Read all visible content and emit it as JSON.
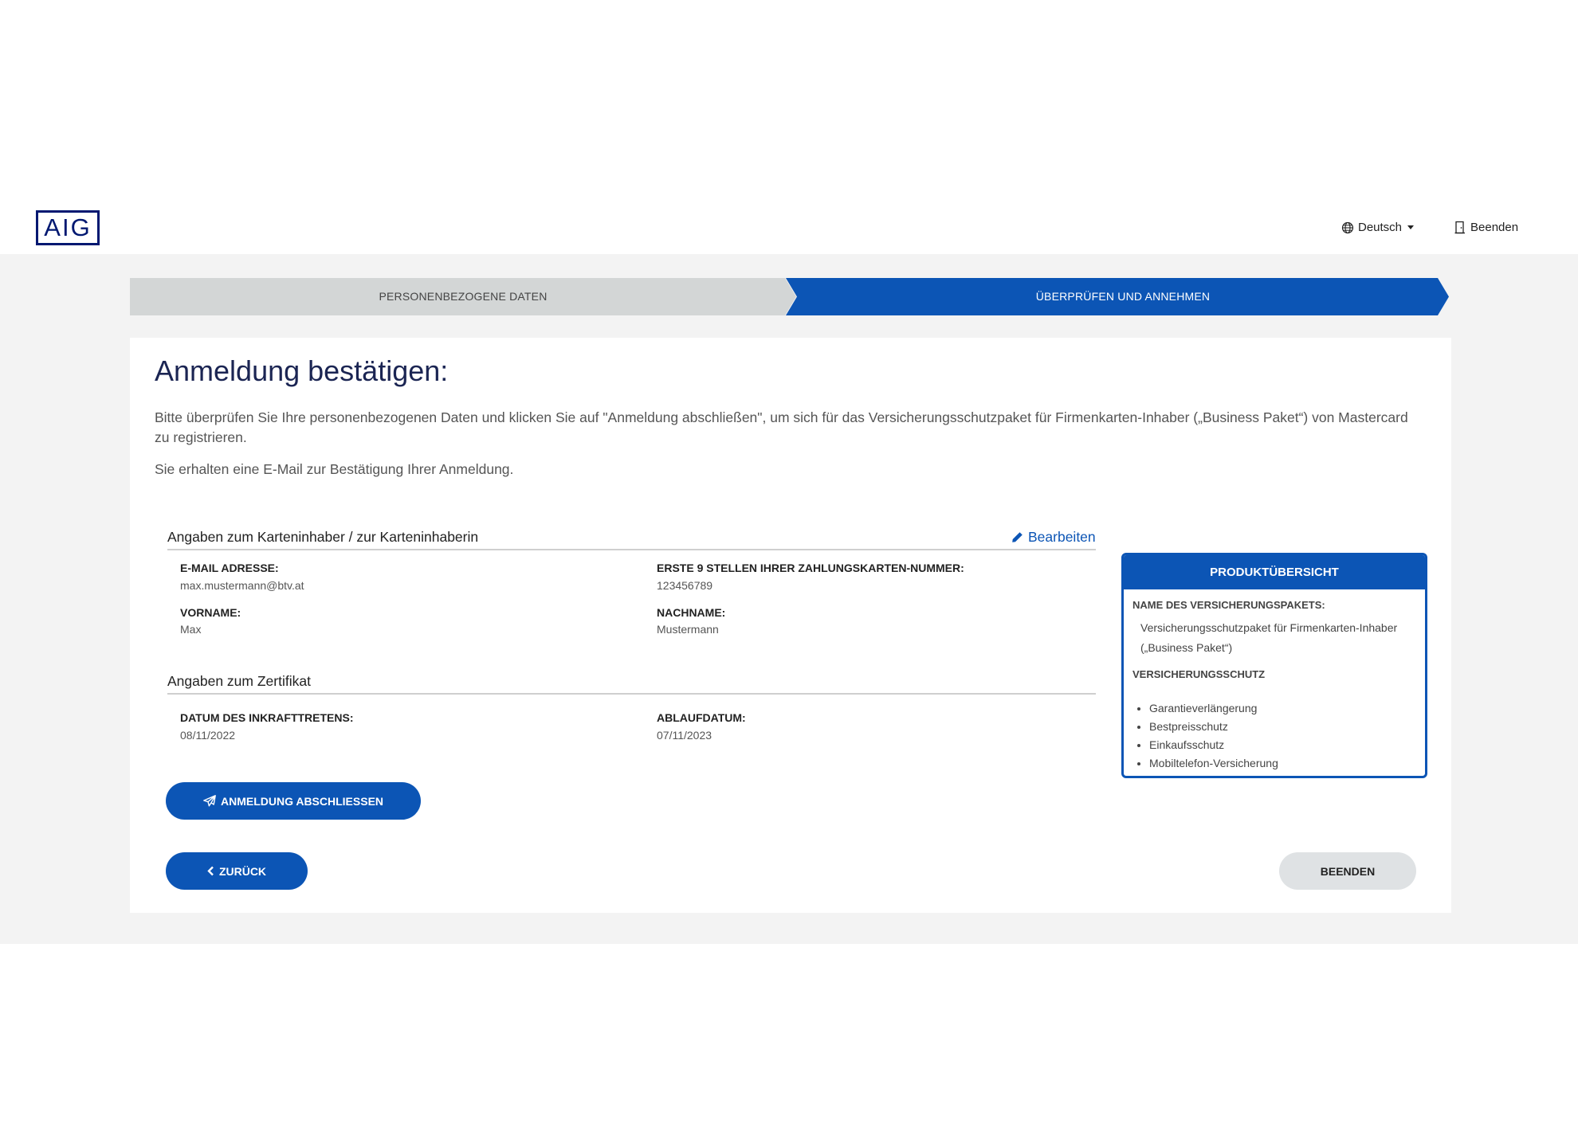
{
  "header": {
    "logo": "AIG",
    "language": "Deutsch",
    "exit_label": "Beenden"
  },
  "stepper": {
    "steps": [
      {
        "label": "PERSONENBEZOGENE DATEN",
        "state": "done"
      },
      {
        "label": "ÜBERPRÜFEN UND ANNEHMEN",
        "state": "active"
      }
    ]
  },
  "main": {
    "title": "Anmeldung bestätigen:",
    "intro": "Bitte überprüfen Sie Ihre personenbezogenen Daten und klicken Sie auf \"Anmeldung abschließen\", um sich für das Versicherungsschutzpaket für Firmenkarten-Inhaber („Business Paket“) von Mastercard zu registrieren.",
    "confirmation_note": "Sie erhalten eine E-Mail zur Bestätigung Ihrer Anmeldung.",
    "cardholder": {
      "heading": "Angaben zum Karteninhaber / zur Karteninhaberin",
      "edit_label": "Bearbeiten",
      "email_label": "E-MAIL ADRESSE:",
      "email_value": "max.mustermann@btv.at",
      "card_label": "ERSTE 9 STELLEN IHRER ZAHLUNGSKARTEN-NUMMER:",
      "card_value": "123456789",
      "firstname_label": "VORNAME:",
      "firstname_value": "Max",
      "lastname_label": "NACHNAME:",
      "lastname_value": "Mustermann"
    },
    "certificate": {
      "heading": "Angaben zum Zertifikat",
      "start_label": "DATUM DES INKRAFTTRETENS:",
      "start_value": "08/11/2022",
      "end_label": "ABLAUFDATUM:",
      "end_value": "07/11/2023"
    },
    "buttons": {
      "submit": "ANMELDUNG ABSCHLIESSEN",
      "back": "ZURÜCK",
      "finish": "BEENDEN"
    }
  },
  "product_panel": {
    "title": "PRODUKTÜBERSICHT",
    "package_label": "NAME DES VERSICHERUNGSPAKETS:",
    "package_value": "Versicherungsschutzpaket für Firmenkarten-Inhaber („Business Paket“)",
    "coverage_label": "VERSICHERUNGSSCHUTZ",
    "coverage_items": [
      "Garantieverlängerung",
      "Bestpreisschutz",
      "Einkaufsschutz",
      "Mobiltelefon-Versicherung"
    ]
  },
  "colors": {
    "brand_blue": "#0c55b5",
    "logo_navy": "#001871",
    "title_navy": "#1b2553",
    "step_inactive": "#d3d6d6"
  }
}
